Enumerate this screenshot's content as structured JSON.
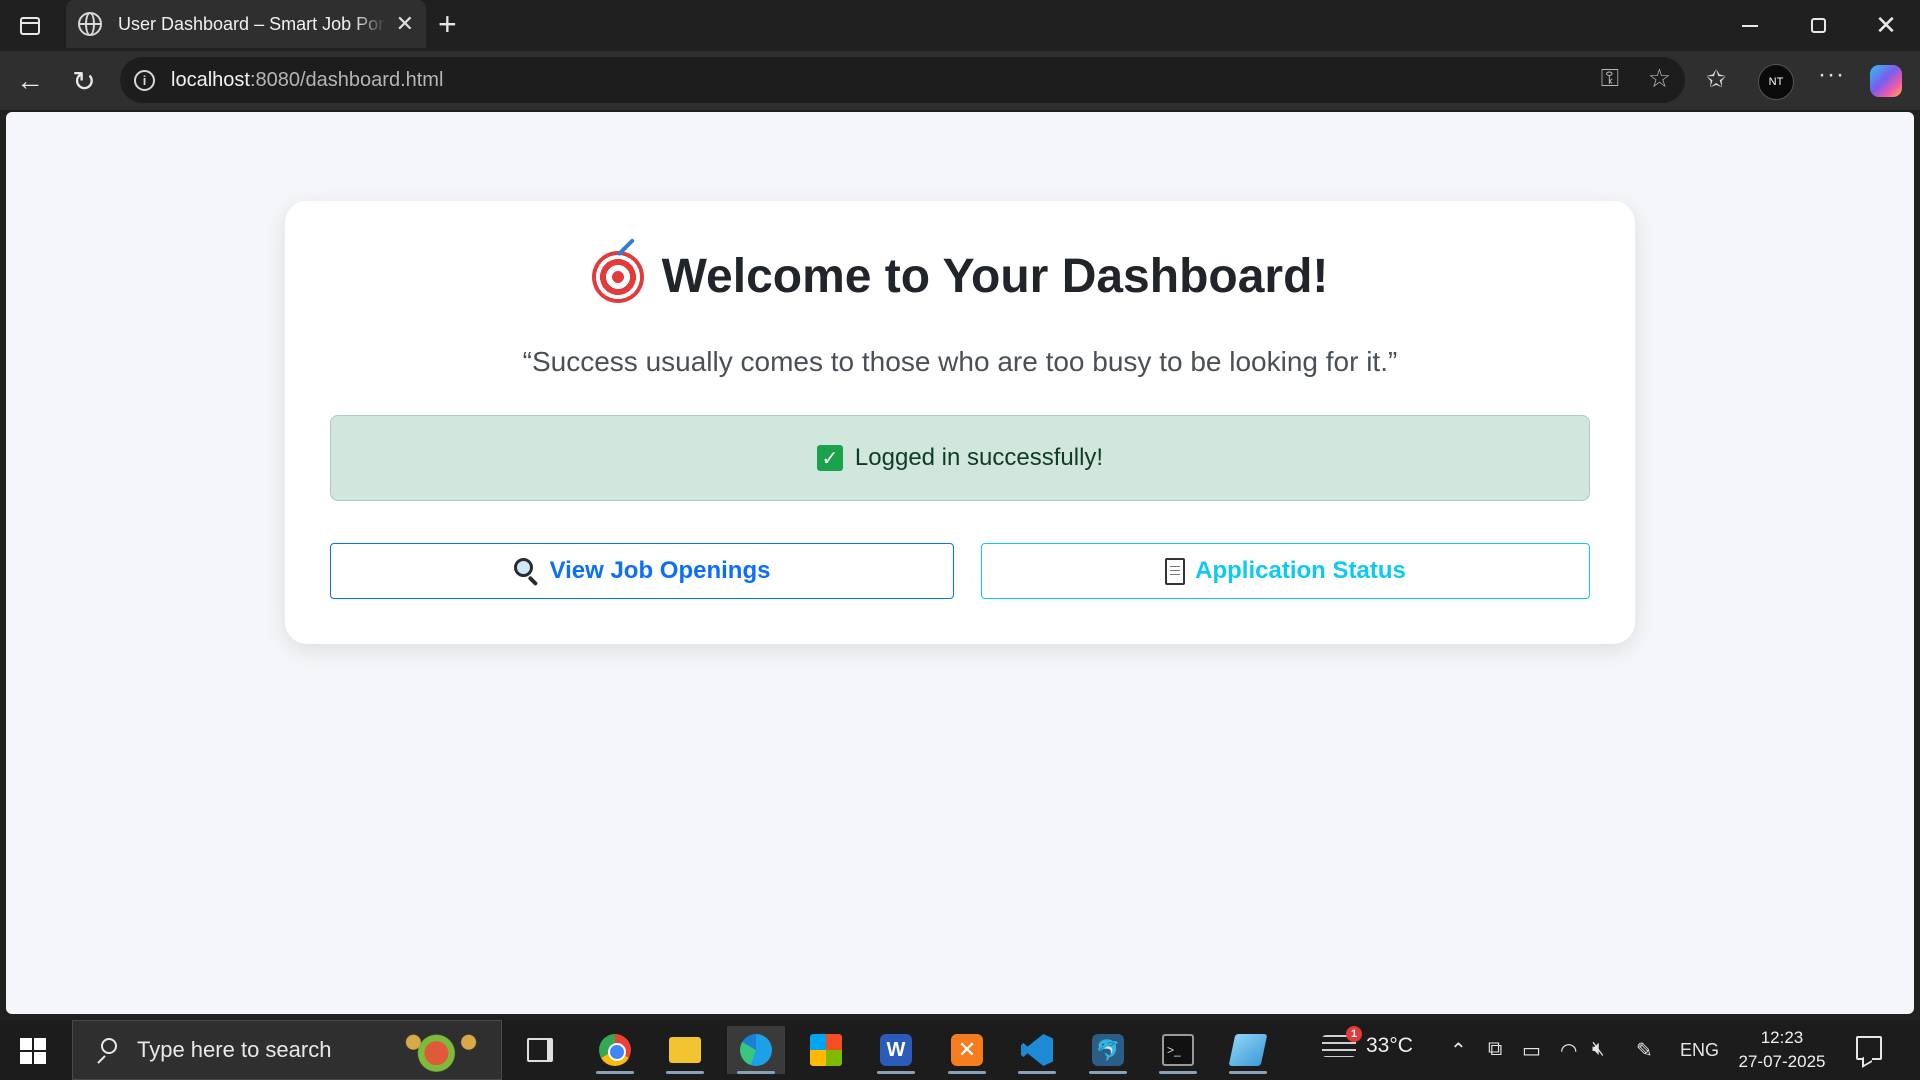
{
  "browser": {
    "tab": {
      "title": "User Dashboard – Smart Job Portal",
      "close_glyph": "✕"
    },
    "new_tab_glyph": "+",
    "address": {
      "host": "localhost",
      "rest": ":8080/dashboard.html"
    },
    "profile_initials": "NT",
    "icons": [
      "sidebar-icon",
      "globe-icon",
      "back-arrow-icon",
      "refresh-icon",
      "info-icon",
      "key-icon",
      "star-icon",
      "favorites-icon",
      "more-icon",
      "copilot-icon"
    ]
  },
  "page": {
    "heading": "Welcome to Your Dashboard!",
    "heading_emoji": "target-icon",
    "quote": "“Success usually comes to those who are too busy to be looking for it.”",
    "alert": {
      "text": "Logged in successfully!",
      "icon": "check-icon",
      "color": "#d1e7dd"
    },
    "buttons": {
      "jobs": {
        "label": "View Job Openings",
        "icon": "magnifier-icon",
        "color": "#0d6efd"
      },
      "status": {
        "label": "Application Status",
        "icon": "document-icon",
        "color": "#0dcaf0"
      }
    }
  },
  "taskbar": {
    "search_placeholder": "Type here to search",
    "apps": [
      "task-view",
      "chrome",
      "file-explorer",
      "edge",
      "microsoft-store",
      "word",
      "xampp",
      "vscode",
      "mysql-workbench",
      "terminal",
      "notes"
    ],
    "word_glyph": "W",
    "xampp_glyph": "✕",
    "mysql_glyph": "🐬",
    "terminal_glyph": ">_",
    "weather": {
      "temp": "33°C",
      "badge": "1"
    },
    "tray": {
      "chevron": "⌃",
      "lang": "ENG"
    },
    "clock": {
      "time": "12:23",
      "date": "27-07-2025"
    }
  }
}
